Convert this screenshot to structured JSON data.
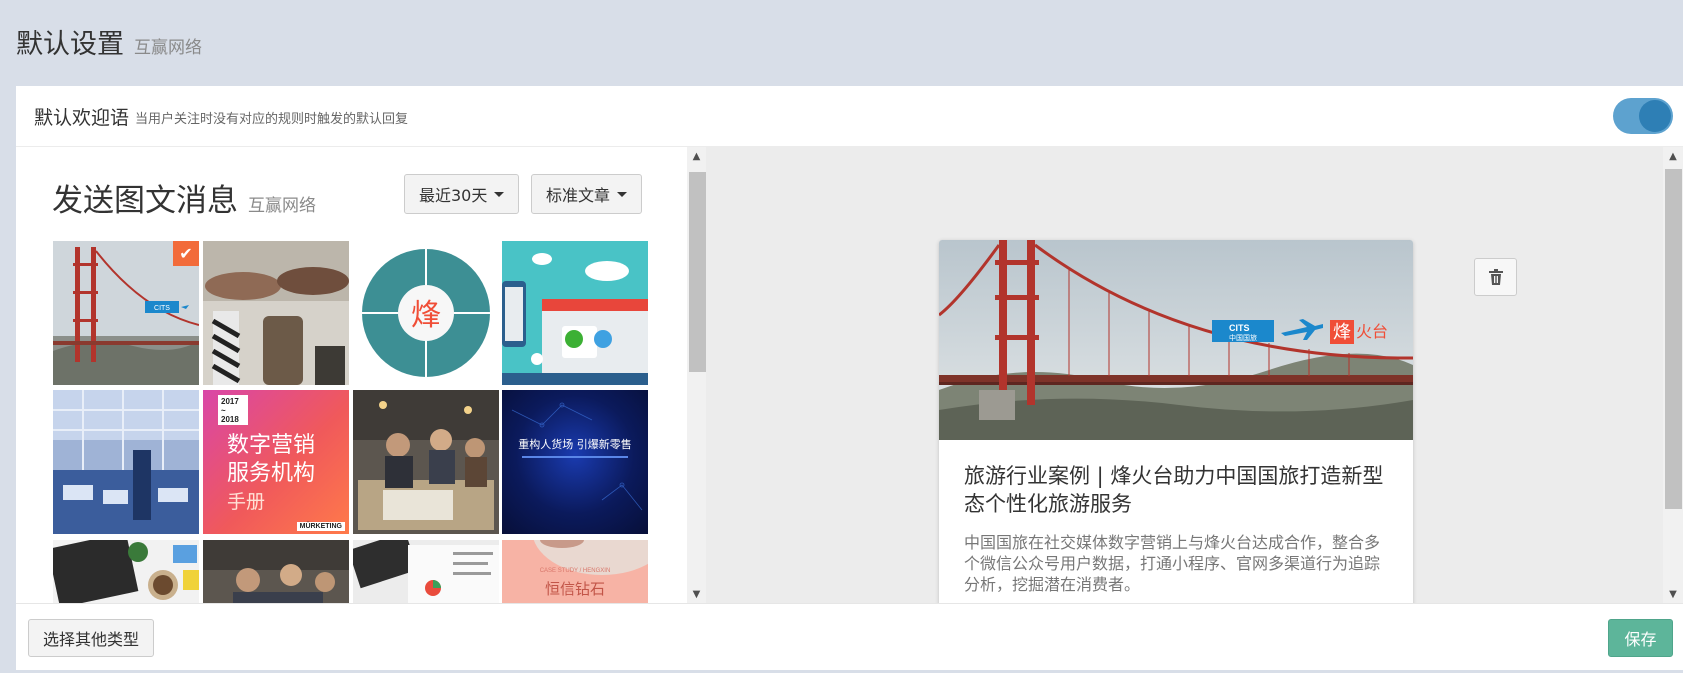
{
  "page": {
    "title": "默认设置",
    "subtitle": "互赢网络"
  },
  "welcome": {
    "title": "默认欢迎语",
    "description": "当用户关注时没有对应的规则时触发的默认回复",
    "toggle_on": true
  },
  "picker": {
    "title": "发送图文消息",
    "subtitle": "互赢网络",
    "range_label": "最近30天",
    "type_label": "标准文章",
    "tiles": [
      {
        "name": "golden-gate-bridge",
        "selected": true,
        "logo_text": "CITS"
      },
      {
        "name": "handshake-fists",
        "selected": false
      },
      {
        "name": "feng-logo-circle",
        "selected": false,
        "glyph": "烽"
      },
      {
        "name": "mobile-store",
        "selected": false
      },
      {
        "name": "office-building",
        "selected": false
      },
      {
        "name": "digital-marketing-handbook",
        "selected": false,
        "year_top": "2017",
        "year_sep": "~",
        "year_bottom": "2018",
        "line1": "数字营销",
        "line2": "服务机构",
        "line3": "手册",
        "brand": "MÜRKETING"
      },
      {
        "name": "team-meeting",
        "selected": false
      },
      {
        "name": "retail-reinvention",
        "selected": false,
        "headline": "重构人货场 引爆新零售"
      },
      {
        "name": "laptop-desk",
        "selected": false
      },
      {
        "name": "team-meeting-2",
        "selected": false
      },
      {
        "name": "tablet-chart",
        "selected": false
      },
      {
        "name": "hengxin-case-study",
        "selected": false,
        "top_line": "CASE STUDY / HENGXIN",
        "headline": "恒信钻石"
      }
    ]
  },
  "preview": {
    "title": "旅游行业案例 | 烽火台助力中国国旅打造新型态个性化旅游服务",
    "description": "中国国旅在社交媒体数字营销上与烽火台达成合作，整合多个微信公众号用户数据，打通小程序、官网多渠道行为追踪分析，挖掘潜在消费者。",
    "logo_cits": "CITS",
    "logo_cits_cn": "中国国旅",
    "logo_feng": "烽",
    "logo_feng_rest": "火台"
  },
  "footer": {
    "other_type_label": "选择其他类型",
    "save_label": "保存"
  },
  "colors": {
    "accent": "#2e7fb5",
    "save": "#5db59a",
    "check": "#f26b3a"
  }
}
